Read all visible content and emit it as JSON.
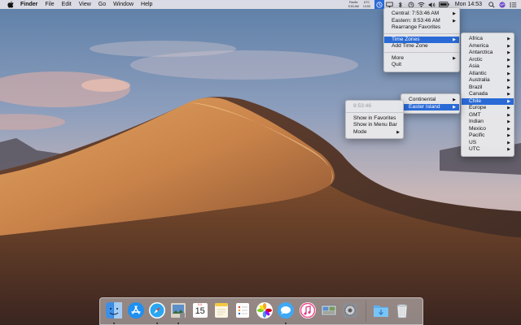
{
  "menubar": {
    "app_name": "Finder",
    "menus": [
      "File",
      "Edit",
      "View",
      "Go",
      "Window",
      "Help"
    ],
    "tz_stack": [
      {
        "name": "Pacific",
        "time": "5:53 AM"
      },
      {
        "name": "UTC",
        "time": "13:53"
      }
    ],
    "clock": "Mon 14:53",
    "battery_label": "",
    "colors": {
      "accent": "#2a6ad6"
    }
  },
  "clock_menu": {
    "items": [
      {
        "label": "Central: 7:53:46 AM",
        "submenu": true
      },
      {
        "label": "Eastern: 8:53:46 AM",
        "submenu": true
      },
      {
        "label": "Rearrange Favorites",
        "submenu": false
      }
    ],
    "group2": [
      {
        "label": "Time Zones",
        "submenu": true,
        "selected": true
      },
      {
        "label": "Add Time Zone",
        "submenu": false
      }
    ],
    "group3": [
      {
        "label": "More",
        "submenu": true
      },
      {
        "label": "Quit",
        "submenu": false
      }
    ]
  },
  "regions_menu": {
    "items": [
      "Africa",
      "America",
      "Antarctica",
      "Arctic",
      "Asia",
      "Atlantic",
      "Australia",
      "Brazil",
      "Canada",
      "Chile",
      "Europe",
      "GMT",
      "Indian",
      "Mexico",
      "Pacific",
      "US",
      "UTC"
    ],
    "selected": "Chile"
  },
  "chile_menu": {
    "items": [
      "Continental",
      "Easter Island"
    ],
    "selected": "Easter Island"
  },
  "easter_menu": {
    "time": "8:53:46",
    "items": [
      {
        "label": "Show in Favorites",
        "submenu": false
      },
      {
        "label": "Show in Menu Bar",
        "submenu": false
      },
      {
        "label": "Mode",
        "submenu": true
      }
    ]
  },
  "dock": {
    "apps": [
      {
        "name": "finder-icon",
        "running": true
      },
      {
        "name": "app-store-icon",
        "running": false
      },
      {
        "name": "safari-icon",
        "running": true
      },
      {
        "name": "preview-icon",
        "running": true
      },
      {
        "name": "calendar-icon",
        "running": false
      },
      {
        "name": "notes-icon",
        "running": false
      },
      {
        "name": "reminders-icon",
        "running": false
      },
      {
        "name": "photos-icon",
        "running": false
      },
      {
        "name": "messages-icon",
        "running": true
      },
      {
        "name": "itunes-icon",
        "running": false
      },
      {
        "name": "photo-browser-icon",
        "running": false
      },
      {
        "name": "system-preferences-icon",
        "running": false
      }
    ],
    "stacks": [
      {
        "name": "downloads-folder-icon"
      },
      {
        "name": "trash-icon"
      }
    ],
    "calendar_month": "JUL",
    "calendar_day": "15"
  }
}
